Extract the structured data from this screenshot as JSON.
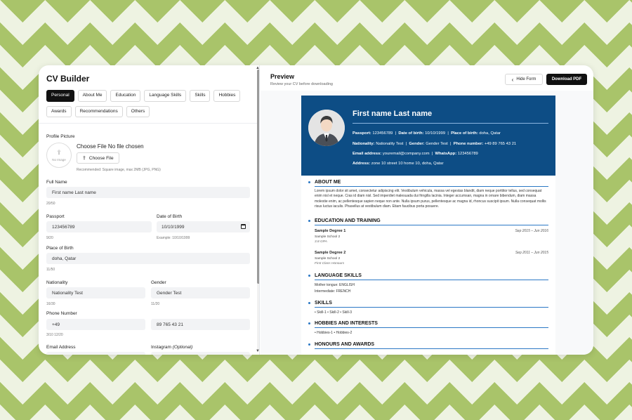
{
  "builder": {
    "title": "CV Builder",
    "tabs": [
      "Personal",
      "About Me",
      "Education",
      "Language Skills",
      "Skills",
      "Hobbies",
      "Awards",
      "Recommendations",
      "Others"
    ]
  },
  "form": {
    "profile_picture_label": "Profile Picture",
    "no_image": "No Image",
    "file_status": "Choose File No file chosen",
    "choose_file": "Choose File",
    "picture_hint": "Recommended: Square image, max 2MB (JPG, PNG)",
    "full_name_label": "Full Name",
    "full_name_value": "First name Last name",
    "full_name_count": "20/50",
    "passport_label": "Passport",
    "passport_value": "123456789",
    "passport_count": "9/20",
    "dob_label": "Date of Birth",
    "dob_value": "10/10/1999",
    "dob_hint": "Example: 10/10/1999",
    "pob_label": "Place of Birth",
    "pob_value": "doha, Qatar",
    "pob_count": "11/50",
    "nationality_label": "Nationality",
    "nationality_value": "Nationality Test",
    "nationality_count": "16/30",
    "gender_label": "Gender",
    "gender_value": "Gender Test",
    "gender_count": "11/20",
    "phone_label": "Phone Number",
    "phone_code": "+49",
    "phone_number": "89 765 43 21",
    "phone_count": "3/10   12/20",
    "email_label": "Email Address",
    "instagram_label": "Instagram",
    "instagram_optional": "(Optional)"
  },
  "preview": {
    "title": "Preview",
    "subtitle": "Review your CV before downloading",
    "hide_form": "Hide Form",
    "download_pdf": "Download PDF"
  },
  "resume": {
    "name": "First name Last name",
    "passport_label": "Passport:",
    "passport": "123456789",
    "dob_label": "Date of birth:",
    "dob": "10/10/1999",
    "pob_label": "Place of birth:",
    "pob": "doha, Qatar",
    "nationality_label": "Nationality:",
    "nationality": "Nationality Test",
    "gender_label": "Gender:",
    "gender": "Gender Test",
    "phone_label": "Phone number:",
    "phone": "+49 89 765 43 21",
    "email_label": "Email address:",
    "email": "youremail@company.com",
    "whatsapp_label": "WhatsApp:",
    "whatsapp": "123456789",
    "address_label": "Address:",
    "address": "zone 10 street 10 home 10, doha, Qatar",
    "separator": "|",
    "about_title": "ABOUT ME",
    "about_text": "Lorem ipsum dolor sit amet, consectetur adipiscing elit. Vestibulum vehicula, massa vel egestas blandit, diam neque porttitor tellus, sed consequat enim nisl et neque. Cras id diam nisl. Sed imperdiet malesuada dui fringilla lacinia. Integer accumsan, magna in ornare bibendum, diam massa molestie enim, ac pellentesque sapien neque non ante. Nulla ipsum purus, pellentesque ac magna id, rhoncus suscipit ipsum. Nulla consequat mollis risus luctus iaculis. Phasellus at vestibulum diam. Etiam faucibus porta posuere.",
    "education_title": "EDUCATION AND TRAINING",
    "degrees": [
      {
        "title": "Sample Degree 1",
        "dates": "Sep 2015 – Jun 2016",
        "school": "Sample School 2",
        "grade": "3.8 GPA"
      },
      {
        "title": "Sample Degree 2",
        "dates": "Sep 2011 – Jun 2015",
        "school": "Sample School 2",
        "grade": "First Class Honours"
      }
    ],
    "language_title": "LANGUAGE SKILLS",
    "mother_tongue": "Mother tongue: ENGLISH",
    "intermediate": "Intermediate: FRENCH",
    "skills_title": "SKILLS",
    "skills": "• Skill-1 • Skill-2 • Skill-3",
    "hobbies_title": "HOBBIES AND INTERESTS",
    "hobbies": "• Hobbies-1 • Hobbies-2",
    "honours_title": "HONOURS AND AWARDS"
  },
  "colors": {
    "resume_header": "#0d4d85",
    "accent": "#2b78c5",
    "page_pattern": "#a9c46a"
  },
  "icons": {
    "upload": "upload-icon",
    "chevron": "chevron-left-icon",
    "calendar": "calendar-icon"
  }
}
